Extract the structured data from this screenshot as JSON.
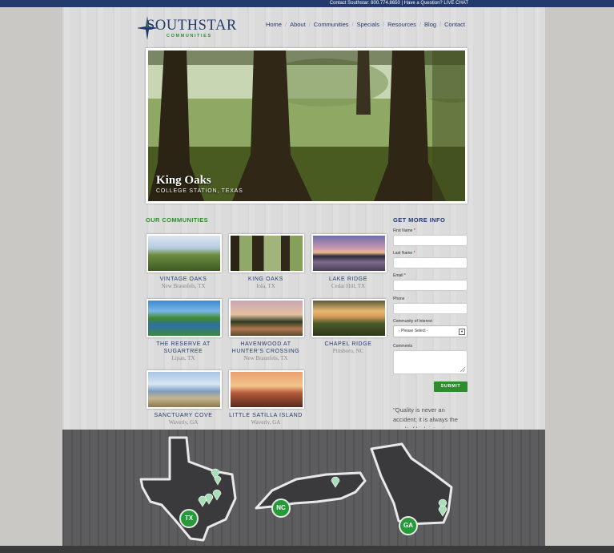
{
  "topbar": {
    "text": "Contact Southstar: 800.774.8650   |   Have a Question? LIVE CHAT"
  },
  "brand": {
    "name": "SOUTHSTAR",
    "tagline": "COMMUNITIES"
  },
  "nav": [
    "Home",
    "About",
    "Communities",
    "Specials",
    "Resources",
    "Blog",
    "Contact"
  ],
  "hero": {
    "title": "King Oaks",
    "subtitle": "COLLEGE STATION, TEXAS"
  },
  "communities": {
    "heading": "OUR COMMUNITIES",
    "items": [
      {
        "name": "VINTAGE OAKS",
        "location": "New Braunfels, TX"
      },
      {
        "name": "KING OAKS",
        "location": "Iola, TX"
      },
      {
        "name": "LAKE RIDGE",
        "location": "Cedar Hill, TX"
      },
      {
        "name": "THE RESERVE AT SUGARTREE",
        "location": "Lipan, TX"
      },
      {
        "name": "HAVENWOOD AT HUNTER'S CROSSING",
        "location": "New Braunfels, TX"
      },
      {
        "name": "CHAPEL RIDGE",
        "location": "Pittsboro, NC"
      },
      {
        "name": "SANCTUARY COVE",
        "location": "Waverly, GA"
      },
      {
        "name": "LITTLE SATILLA ISLAND",
        "location": "Waverly, GA"
      }
    ]
  },
  "form": {
    "heading": "GET MORE INFO",
    "first_name_label": "First Name",
    "last_name_label": "Last Name",
    "email_label": "Email",
    "phone_label": "Phone",
    "community_label": "Community of Interest",
    "community_value": "- Please Select -",
    "comments_label": "Comments",
    "submit_label": "SUBMIT",
    "required_mark": "*"
  },
  "quote": {
    "text": "\"Quality is never an accident; it is always the result of high intention"
  },
  "map": {
    "states": [
      "TX",
      "NC",
      "GA"
    ]
  },
  "colors": {
    "navy": "#233a6d",
    "green": "#2e8b2e",
    "map_bg": "#58585a",
    "state_fill": "#3a3a3c",
    "pin": "#a9dfb8"
  }
}
